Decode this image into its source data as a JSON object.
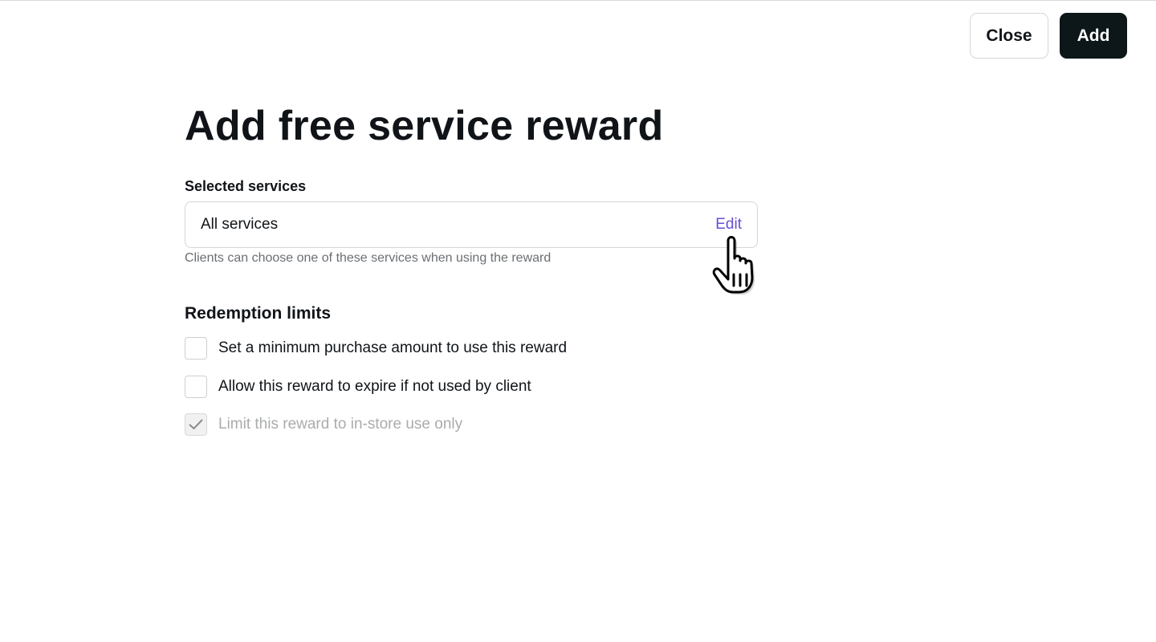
{
  "header": {
    "close_label": "Close",
    "add_label": "Add"
  },
  "page": {
    "title": "Add free service reward"
  },
  "selected_services": {
    "label": "Selected services",
    "value": "All services",
    "edit_label": "Edit",
    "helper": "Clients can choose one of these services when using the reward"
  },
  "redemption": {
    "title": "Redemption limits",
    "options": [
      {
        "label": "Set a minimum purchase amount to use this reward",
        "checked": false,
        "disabled": false
      },
      {
        "label": "Allow this reward to expire if not used by client",
        "checked": false,
        "disabled": false
      },
      {
        "label": "Limit this reward to in-store use only",
        "checked": true,
        "disabled": true
      }
    ]
  },
  "colors": {
    "primary_button": "#0d1619",
    "link": "#6a4fd6",
    "muted_text": "#6b6f73",
    "disabled_text": "#a9acae"
  },
  "icons": {
    "cursor": "pointer-hand-icon",
    "check": "checkmark-icon"
  }
}
